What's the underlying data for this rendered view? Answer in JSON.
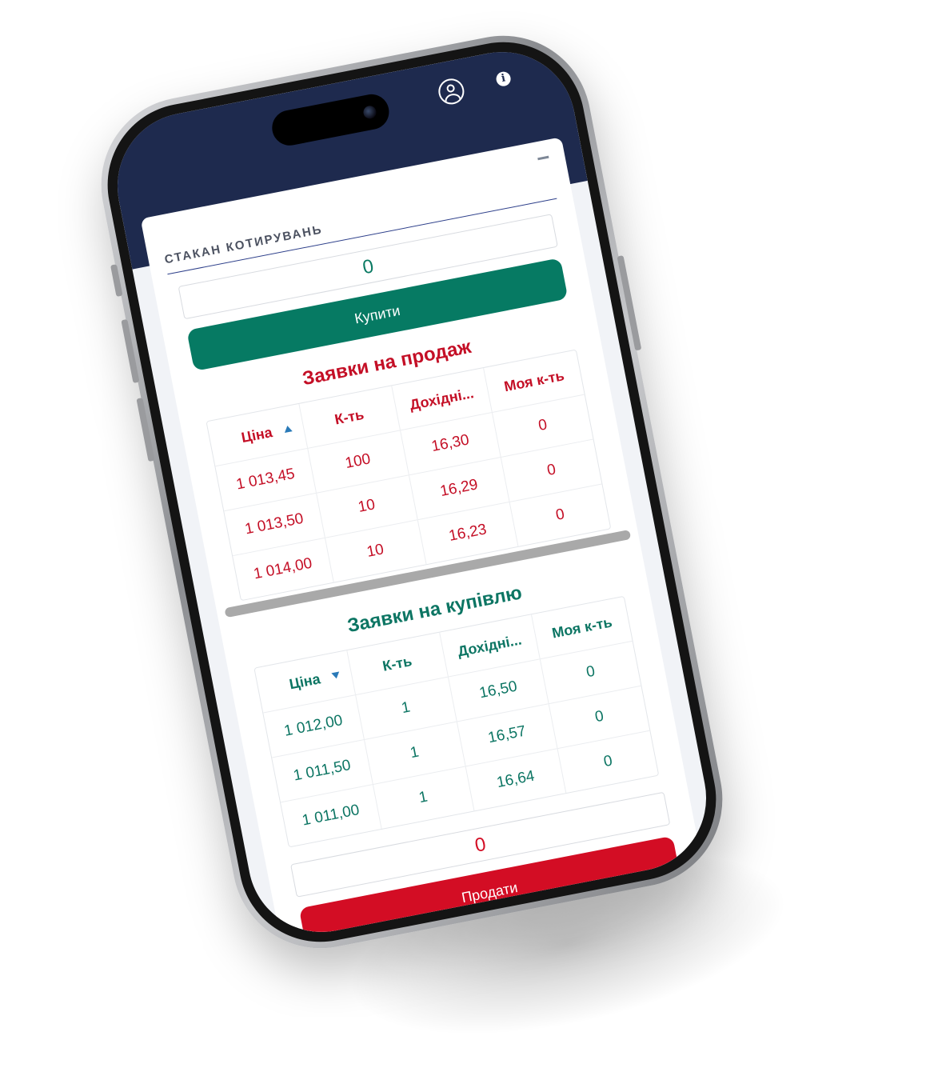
{
  "header": {
    "menu_icon": "hamburger-menu-icon",
    "profile_icon": "user-circle-icon",
    "info_icon": "info-icon",
    "info_glyph": "i"
  },
  "panel": {
    "title": "СТАКАН КОТИРУВАНЬ",
    "collapse_icon": "minus-icon"
  },
  "buy": {
    "quantity_value": "0",
    "button_label": "Купити"
  },
  "sell_orders": {
    "title": "Заявки на продаж",
    "columns": [
      "Ціна",
      "К-ть",
      "Дохідні...",
      "Моя к-ть"
    ],
    "rows": [
      [
        "1 013,45",
        "100",
        "16,30",
        "0"
      ],
      [
        "1 013,50",
        "10",
        "16,29",
        "0"
      ],
      [
        "1 014,00",
        "10",
        "16,23",
        "0"
      ]
    ]
  },
  "buy_orders": {
    "title": "Заявки на купівлю",
    "columns": [
      "Ціна",
      "К-ть",
      "Дохідні...",
      "Моя к-ть"
    ],
    "rows": [
      [
        "1 012,00",
        "1",
        "16,50",
        "0"
      ],
      [
        "1 011,50",
        "1",
        "16,57",
        "0"
      ],
      [
        "1 011,00",
        "1",
        "16,64",
        "0"
      ]
    ]
  },
  "sell": {
    "quantity_value": "0",
    "button_label": "Продати"
  },
  "colors": {
    "header_bg": "#1e2a4e",
    "buy_green": "#067a63",
    "sell_red": "#d30d24"
  }
}
